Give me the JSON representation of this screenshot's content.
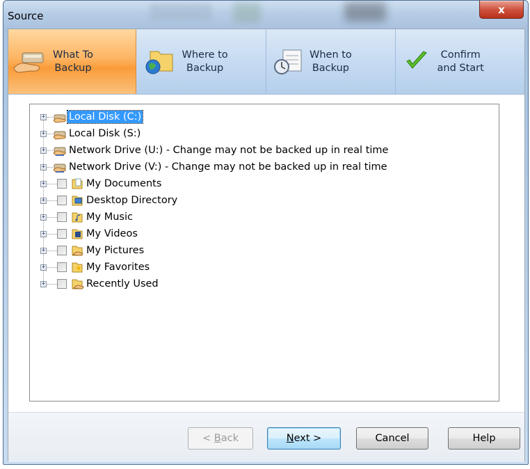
{
  "window": {
    "title": "Source",
    "close_glyph": "x"
  },
  "wizard_steps": [
    {
      "label": "What To\nBackup",
      "icon": "hand-drive-icon",
      "active": true
    },
    {
      "label": "Where to\nBackup",
      "icon": "globe-folder-icon",
      "active": false
    },
    {
      "label": "When to\nBackup",
      "icon": "clock-calendar-icon",
      "active": false
    },
    {
      "label": "Confirm\nand Start",
      "icon": "checkmark-icon",
      "active": false
    }
  ],
  "tree": [
    {
      "label": "Local Disk (C:)",
      "icon": "shared-drive-icon",
      "checkbox": false,
      "selected": true
    },
    {
      "label": "Local Disk (S:)",
      "icon": "shared-drive-icon",
      "checkbox": false,
      "selected": false
    },
    {
      "label": "Network Drive (U:) - Change may not be backed up in real time",
      "icon": "network-drive-icon",
      "checkbox": false,
      "selected": false
    },
    {
      "label": "Network Drive (V:) - Change may not be backed up in real time",
      "icon": "network-drive-icon",
      "checkbox": false,
      "selected": false
    },
    {
      "label": "My Documents",
      "icon": "documents-icon",
      "checkbox": true,
      "selected": false
    },
    {
      "label": "Desktop Directory",
      "icon": "desktop-icon",
      "checkbox": true,
      "selected": false
    },
    {
      "label": "My Music",
      "icon": "music-icon",
      "checkbox": true,
      "selected": false
    },
    {
      "label": "My Videos",
      "icon": "videos-icon",
      "checkbox": true,
      "selected": false
    },
    {
      "label": "My Pictures",
      "icon": "pictures-icon",
      "checkbox": true,
      "selected": false
    },
    {
      "label": "My Favorites",
      "icon": "favorites-icon",
      "checkbox": true,
      "selected": false
    },
    {
      "label": "Recently Used",
      "icon": "recent-icon",
      "checkbox": true,
      "selected": false
    }
  ],
  "buttons": {
    "back_prefix": "< ",
    "back_accel": "B",
    "back_rest": "ack",
    "next_accel": "N",
    "next_rest": "ext >",
    "cancel": "Cancel",
    "help": "Help"
  }
}
